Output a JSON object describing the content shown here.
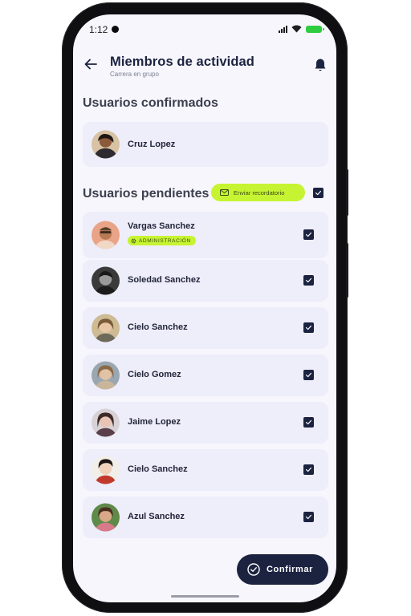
{
  "status_bar": {
    "time": "1:12"
  },
  "header": {
    "title": "Miembros de actividad",
    "subtitle": "Carrera en grupo",
    "back_icon": "arrow-left-icon",
    "bell_icon": "bell-icon"
  },
  "confirmed": {
    "title": "Usuarios confirmados",
    "users": [
      {
        "name": "Cruz Lopez"
      }
    ]
  },
  "pending": {
    "title": "Usuarios pendientes",
    "reminder_label": "Enviar recordatorio",
    "select_all_checked": true,
    "users": [
      {
        "name": "Vargas Sanchez",
        "badge": "ADMINISTRACIÓN",
        "checked": true
      },
      {
        "name": "Soledad Sanchez",
        "checked": true
      },
      {
        "name": "Cielo Sanchez",
        "checked": true
      },
      {
        "name": "Cielo Gomez",
        "checked": true
      },
      {
        "name": "Jaime Lopez",
        "checked": true
      },
      {
        "name": "Cielo Sanchez",
        "checked": true
      },
      {
        "name": "Azul Sanchez",
        "checked": true
      }
    ]
  },
  "confirm_button": {
    "label": "Confirmar"
  },
  "colors": {
    "navy": "#1b2340",
    "lime": "#c6f432",
    "card_bg": "#eeedfa",
    "screen_bg": "#f7f6fd"
  }
}
